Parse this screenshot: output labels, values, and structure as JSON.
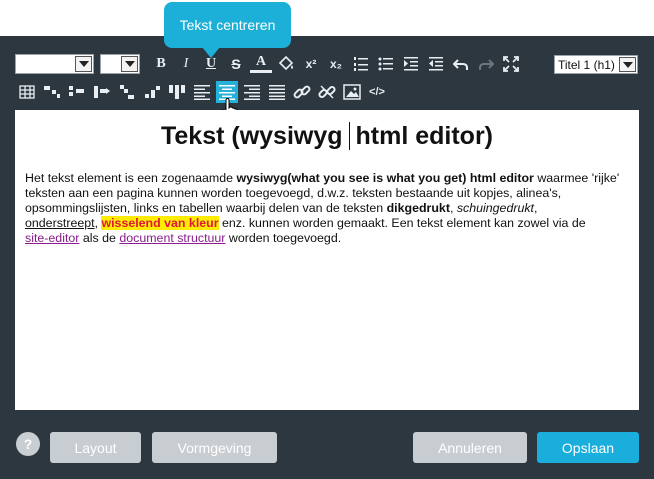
{
  "tooltip": {
    "text": "Tekst centreren"
  },
  "toolbar": {
    "font_select": "",
    "size_select": "",
    "heading_select": "Titel 1 (h1)",
    "bold_label": "B",
    "italic_label": "I",
    "underline_label": "U",
    "strike_label": "S",
    "font_color_label": "A",
    "superscript_label": "x²",
    "subscript_label": "x₂",
    "code_label": "</>"
  },
  "editor": {
    "title_part1": "Tekst (wysiwyg",
    "title_part2": "html editor)",
    "p1": "Het tekst element is een zogenaamde ",
    "p1_bold": "wysiwyg(what you see is what you get) html editor",
    "p2": " waarmee 'rijke' teksten aan een pagina kunnen worden toegevoegd, d.w.z. teksten bestaande uit kopjes, alinea's, opsommingslijsten, links en tabellen waarbij delen van de teksten ",
    "p2_bold": "dikgedrukt",
    "p2_sep": ", ",
    "p2_italic": "schuingedrukt",
    "p2_end": ",",
    "underlined": "onderstreept",
    "sep": ", ",
    "highlight": "wisselend van kleur",
    "p3": " enz. kunnen worden gemaakt. Een tekst element kan zowel via de ",
    "link1": "site-editor",
    "p4": " als de ",
    "link2": "document structuur",
    "p5": " worden toegevoegd."
  },
  "footer": {
    "help": "?",
    "layout": "Layout",
    "vormgeving": "Vormgeving",
    "annuleren": "Annuleren",
    "opslaan": "Opslaan"
  },
  "colors": {
    "panel": "#2d3740",
    "accent": "#19aedb",
    "highlight_bg": "#ffec00",
    "highlight_fg": "#e0173a",
    "link": "#8a1c8e"
  }
}
